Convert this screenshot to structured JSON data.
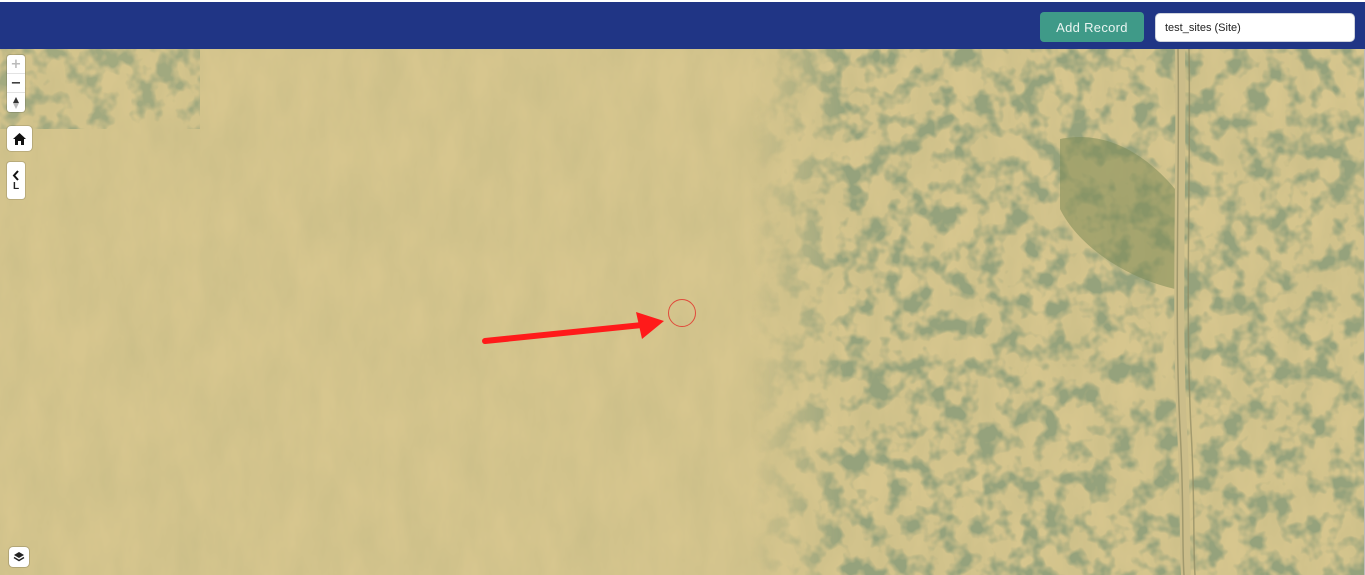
{
  "toolbar": {
    "add_record_label": "Add Record",
    "layer_select_value": "test_sites (Site)",
    "accent_color": "#203585",
    "button_color": "#3f9a88"
  },
  "map_controls": {
    "zoom_in": "+",
    "zoom_out": "−",
    "reset_north": "north-arrow-icon",
    "home": "home-icon",
    "legend_toggle_chevron": "‹",
    "legend_toggle_label": "L",
    "layers": "layers-icon"
  },
  "map": {
    "basemap": "aerial imagery",
    "marker_color": "#e04a3a",
    "annotation_arrow_color": "#ff1a1a"
  }
}
